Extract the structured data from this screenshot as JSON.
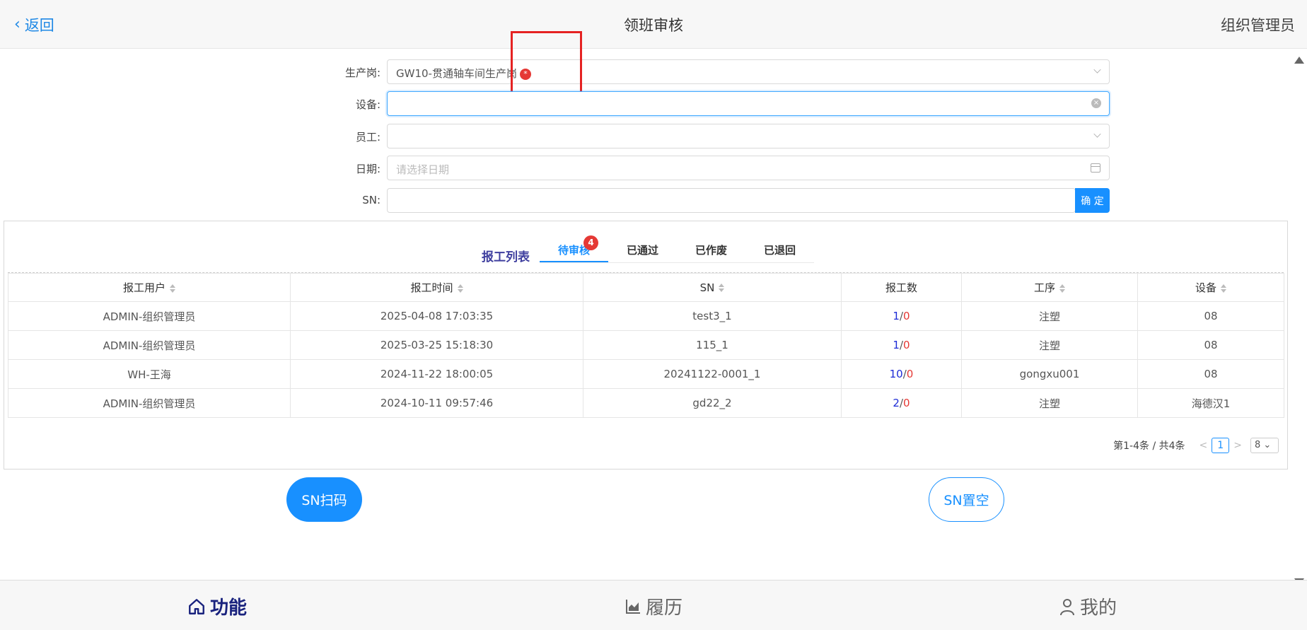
{
  "header": {
    "back_label": "返回",
    "title": "领班审核",
    "role": "组织管理员"
  },
  "form": {
    "post_label": "生产岗:",
    "post_value": "GW10-贯通轴车间生产岗",
    "required_mark": "*",
    "device_label": "设备:",
    "device_value": "",
    "staff_label": "员工:",
    "staff_value": "",
    "date_label": "日期:",
    "date_placeholder": "请选择日期",
    "sn_label": "SN:",
    "sn_value": "",
    "confirm_label": "确 定"
  },
  "list": {
    "title": "报工列表",
    "tabs": [
      {
        "label": "待审核",
        "badge": "4",
        "active": true
      },
      {
        "label": "已通过"
      },
      {
        "label": "已作废"
      },
      {
        "label": "已退回"
      }
    ],
    "columns": [
      "报工用户",
      "报工时间",
      "SN",
      "报工数",
      "工序",
      "设备"
    ],
    "rows": [
      {
        "user": "ADMIN-组织管理员",
        "time": "2025-04-08 17:03:35",
        "sn": "test3_1",
        "count_ok": "1",
        "count_bad": "0",
        "process": "注塑",
        "device": "08"
      },
      {
        "user": "ADMIN-组织管理员",
        "time": "2025-03-25 15:18:30",
        "sn": "115_1",
        "count_ok": "1",
        "count_bad": "0",
        "process": "注塑",
        "device": "08"
      },
      {
        "user": "WH-王海",
        "time": "2024-11-22 18:00:05",
        "sn": "20241122-0001_1",
        "count_ok": "10",
        "count_bad": "0",
        "process": "gongxu001",
        "device": "08"
      },
      {
        "user": "ADMIN-组织管理员",
        "time": "2024-10-11 09:57:46",
        "sn": "gd22_2",
        "count_ok": "2",
        "count_bad": "0",
        "process": "注塑",
        "device": "海德汉1"
      }
    ],
    "pagination": {
      "total_text": "第1-4条 / 共4条",
      "current_page": "1",
      "page_size": "8"
    }
  },
  "actions": {
    "scan_label": "SN扫码",
    "clear_label": "SN置空"
  },
  "bottom_nav": {
    "items": [
      {
        "label": "功能",
        "icon": "home-icon",
        "active": true
      },
      {
        "label": "履历",
        "icon": "chart-icon"
      },
      {
        "label": "我的",
        "icon": "user-icon"
      }
    ]
  },
  "colors": {
    "primary": "#1890ff",
    "danger": "#e53935",
    "nav_active": "#1a237e"
  }
}
